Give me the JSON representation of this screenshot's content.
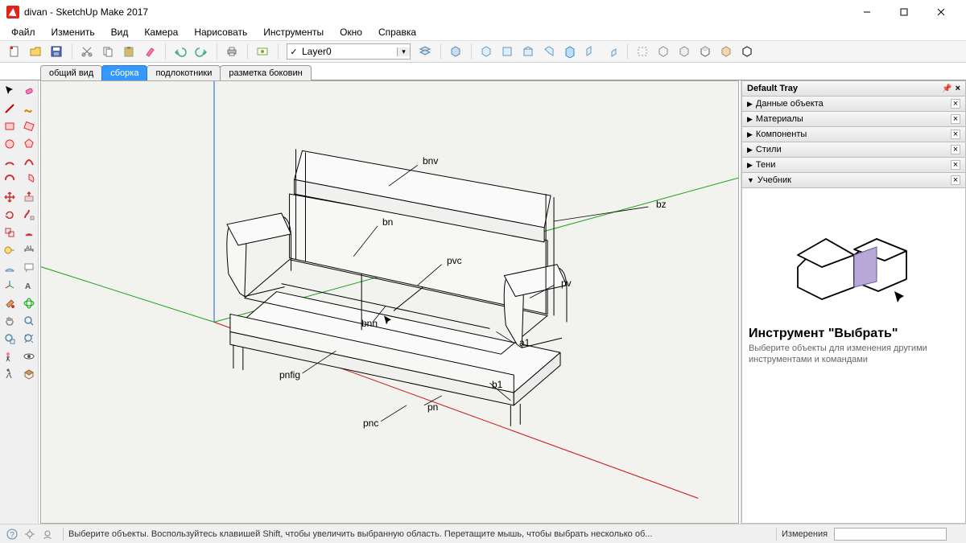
{
  "window": {
    "title": "divan - SketchUp Make 2017",
    "minimize_tip": "Свернуть",
    "maximize_tip": "Развернуть",
    "close_tip": "Закрыть"
  },
  "menu": {
    "items": [
      "Файл",
      "Изменить",
      "Вид",
      "Камера",
      "Нарисовать",
      "Инструменты",
      "Окно",
      "Справка"
    ]
  },
  "layer": {
    "check": "✓",
    "value": "Layer0"
  },
  "scene_tabs": {
    "items": [
      "общий вид",
      "сборка",
      "подлокотники",
      "разметка боковин"
    ],
    "active_index": 1
  },
  "annotations": {
    "bnv": "bnv",
    "bz": "bz",
    "bn": "bn",
    "pvc": "pvc",
    "pv": "pv",
    "bnn": "bnn",
    "a1": "a1",
    "b1": "b1",
    "pnfig": "pnfig",
    "pn": "pn",
    "pnc": "pnc"
  },
  "tray": {
    "title": "Default Tray",
    "panels": [
      "Данные объекта",
      "Материалы",
      "Компоненты",
      "Стили",
      "Тени",
      "Учебник"
    ],
    "expanded_index": 5
  },
  "instructor": {
    "title": "Инструмент \"Выбрать\"",
    "desc": "Выберите объекты для изменения другими инструментами и командами"
  },
  "status": {
    "hint": "Выберите объекты. Воспользуйтесь клавишей Shift, чтобы увеличить выбранную область. Перетащите мышь, чтобы выбрать несколько об...",
    "measure_label": "Измерения",
    "measure_value": ""
  }
}
